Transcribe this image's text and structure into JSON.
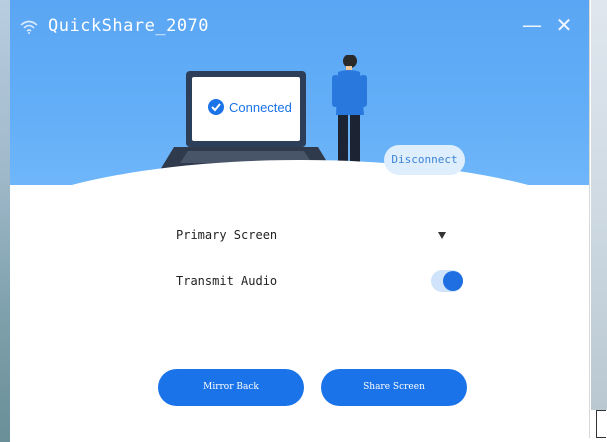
{
  "app": {
    "title": "QuickShare_2070"
  },
  "window_controls": {
    "minimize": "—",
    "close": "✕"
  },
  "status": {
    "connected_text": "Connected"
  },
  "header": {
    "disconnect_label": "Disconnect"
  },
  "settings": {
    "primary_screen_label": "Primary Screen",
    "transmit_audio_label": "Transmit Audio",
    "transmit_audio_enabled": true
  },
  "actions": {
    "mirror_back_label": "Mirror Back",
    "share_screen_label": "Share Screen"
  },
  "colors": {
    "header_blue": "#5aa6f4",
    "accent_blue": "#1a73e8",
    "disconnect_bg": "#dfeefd"
  },
  "icons": {
    "wifi": "wifi-icon",
    "dropdown": "dropdown-arrow-icon",
    "check": "check-circle-icon"
  }
}
